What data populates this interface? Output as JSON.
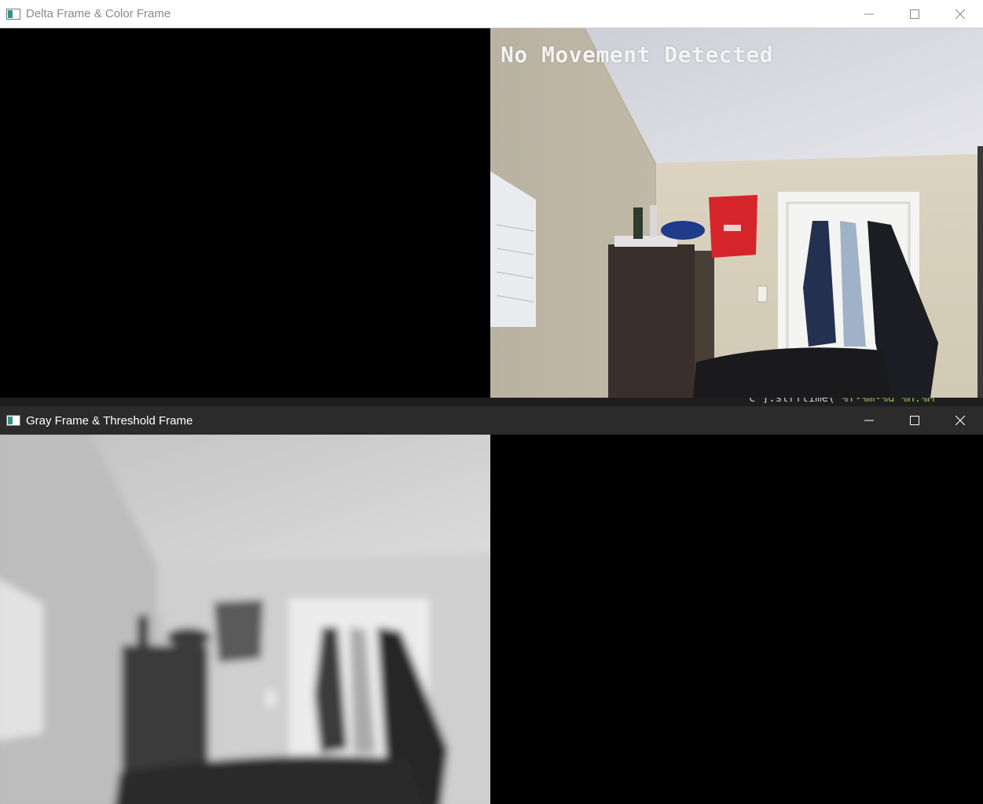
{
  "windows": [
    {
      "title": "Delta Frame & Color Frame",
      "overlay_text": "No Movement Detected"
    },
    {
      "title": "Gray Frame & Threshold Frame"
    }
  ],
  "window_controls": {
    "minimize_icon": "minimize-icon",
    "maximize_icon": "maximize-icon",
    "close_icon": "close-icon"
  },
  "background_editor": {
    "partial_code_text": "c'].strftime(",
    "partial_code_string": "\"%Y-%m-%d %H:%M"
  },
  "colors": {
    "titlebar_light": "#ffffff",
    "titlebar_dark": "#2b2b2b",
    "frame_black": "#000000"
  }
}
